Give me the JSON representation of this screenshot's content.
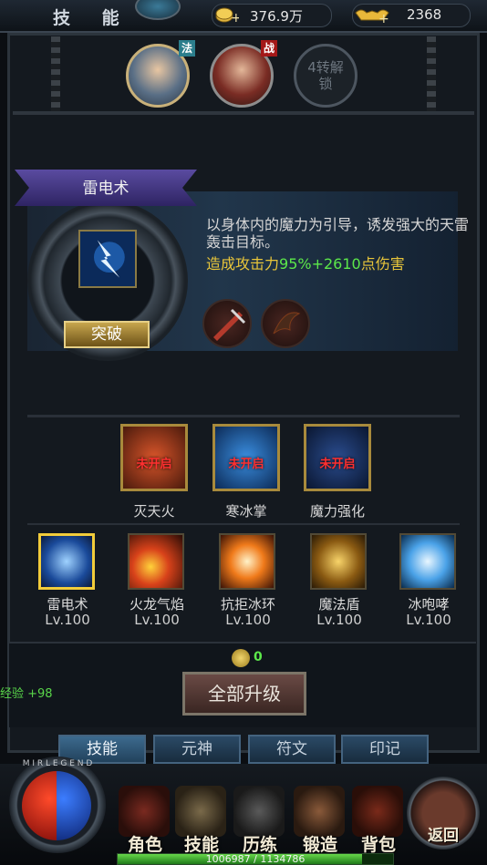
{
  "header": {
    "title": "技 能",
    "gold": "376.9万",
    "ingots": "2368"
  },
  "characters": {
    "mage_badge": "法",
    "warrior_badge": "战",
    "locked_slot": "4转解锁"
  },
  "skill_detail": {
    "name": "雷电术",
    "description": "以身体内的魔力为引导，诱发强大的天雷轰击目标。",
    "effect_prefix": "造成攻击力",
    "effect_value": "95%+2610",
    "effect_suffix": "点伤害",
    "breakthrough_button": "突破"
  },
  "locked_skills": [
    {
      "name": "灭天火",
      "status": "未开启"
    },
    {
      "name": "寒冰掌",
      "status": "未开启"
    },
    {
      "name": "魔力强化",
      "status": "未开启"
    }
  ],
  "skills": [
    {
      "name": "雷电术",
      "level": "Lv.100",
      "selected": true
    },
    {
      "name": "火龙气焰",
      "level": "Lv.100"
    },
    {
      "name": "抗拒冰环",
      "level": "Lv.100"
    },
    {
      "name": "魔法盾",
      "level": "Lv.100"
    },
    {
      "name": "冰咆哮",
      "level": "Lv.100"
    }
  ],
  "upgrade": {
    "coin_count": "0",
    "button": "全部升级"
  },
  "exp_gain": "经验 +98",
  "tabs": [
    "技能",
    "元神",
    "符文",
    "印记"
  ],
  "nav": {
    "items": [
      "角色",
      "技能",
      "历练",
      "锻造",
      "背包"
    ],
    "back": "返回",
    "orb_letters": "MIRLEGEND"
  },
  "exp_bar": {
    "text": "1006987 / 1134786",
    "fraction": 0.8874
  },
  "colors": {
    "accent_gold": "#e8c53a",
    "effect_green": "#5ce84a",
    "lock_red": "#ff3030"
  }
}
